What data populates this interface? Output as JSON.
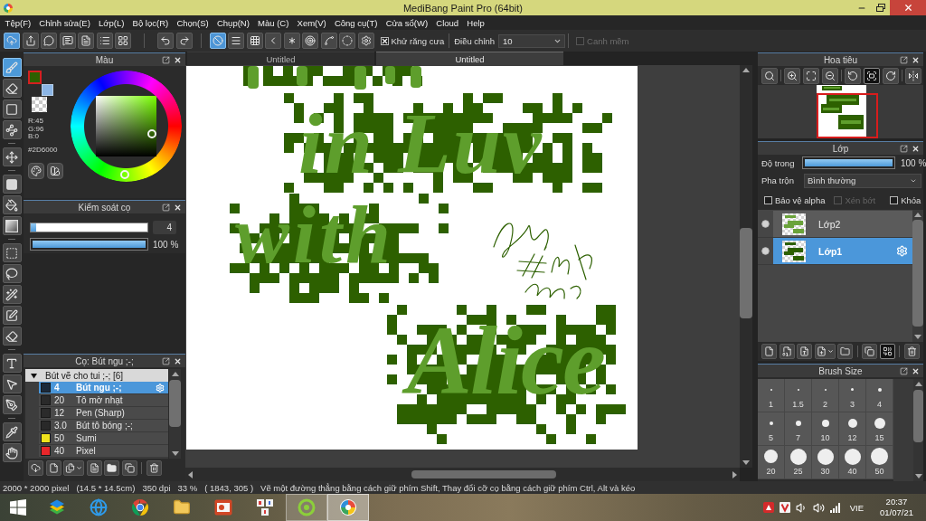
{
  "window": {
    "title": "MediBang Paint Pro (64bit)"
  },
  "menu": [
    "Tệp(F)",
    "Chỉnh sửa(E)",
    "Lớp(L)",
    "Bộ lọc(R)",
    "Chọn(S)",
    "Chụp(N)",
    "Màu (C)",
    "Xem(V)",
    "Công cụ(T)",
    "Cửa sổ(W)",
    "Cloud",
    "Help"
  ],
  "toolbar": {
    "groups": [
      {
        "items": [
          {
            "kind": "cloud-upload",
            "selected": true
          },
          {
            "kind": "share",
            "selected": false
          },
          {
            "kind": "bubble",
            "selected": false
          },
          {
            "kind": "comment",
            "selected": false
          },
          {
            "kind": "document",
            "selected": false
          },
          {
            "kind": "list",
            "selected": false
          },
          {
            "kind": "grid-settings",
            "selected": false
          }
        ]
      },
      {
        "items": [
          {
            "kind": "undo",
            "selected": false
          },
          {
            "kind": "redo",
            "selected": false
          }
        ]
      },
      {
        "items": [
          {
            "kind": "snap-off",
            "selected": true
          },
          {
            "kind": "snap-parallel",
            "selected": false
          },
          {
            "kind": "snap-grid",
            "selected": false
          },
          {
            "kind": "snap-perspective",
            "selected": false
          },
          {
            "kind": "snap-radial",
            "selected": false
          },
          {
            "kind": "snap-concentric",
            "selected": false
          },
          {
            "kind": "snap-curve",
            "selected": false
          },
          {
            "kind": "snap-ellipse",
            "selected": false
          },
          {
            "kind": "snap-settings",
            "selected": false
          }
        ]
      }
    ],
    "antialias": {
      "label": "Khử răng cưa",
      "checked": true
    },
    "correction": {
      "label": "Điều chỉnh",
      "value": "10"
    },
    "soft_edge": {
      "label": "Canh mềm",
      "checked": false,
      "disabled": true
    }
  },
  "tool_strip": {
    "groups": [
      {
        "items": [
          {
            "kind": "brush",
            "selected": true
          },
          {
            "kind": "eraser",
            "selected": false
          },
          {
            "kind": "rect-outline",
            "selected": false
          },
          {
            "kind": "dot-line",
            "selected": false
          }
        ]
      },
      {
        "items": [
          {
            "kind": "move",
            "selected": false
          }
        ]
      },
      {
        "items": [
          {
            "kind": "fill-rect",
            "selected": false
          },
          {
            "kind": "bucket",
            "selected": false
          },
          {
            "kind": "gradient",
            "selected": false
          }
        ]
      },
      {
        "items": [
          {
            "kind": "select-rect",
            "selected": false
          },
          {
            "kind": "lasso",
            "selected": false
          },
          {
            "kind": "wand",
            "selected": false
          },
          {
            "kind": "select-pen",
            "selected": false
          },
          {
            "kind": "select-eraser",
            "selected": false
          }
        ]
      },
      {
        "items": [
          {
            "kind": "text",
            "selected": false
          },
          {
            "kind": "operation",
            "selected": false
          },
          {
            "kind": "divide",
            "selected": false
          }
        ]
      },
      {
        "items": [
          {
            "kind": "eyedropper",
            "selected": false
          },
          {
            "kind": "hand",
            "selected": false
          }
        ]
      }
    ]
  },
  "color_panel": {
    "title": "Màu",
    "swatches": [
      {
        "kind": "foreground",
        "color": "#2d6000"
      },
      {
        "kind": "background",
        "color": "#8cb6e6"
      }
    ],
    "rgb": [
      "R:45",
      "G:96",
      "B:0"
    ],
    "hex": "#2D6000"
  },
  "brush_control": {
    "title": "Kiểm soát cọ",
    "size": {
      "level": 0.05,
      "value": "4"
    },
    "opacity": {
      "level": 1,
      "reading": "100 %"
    }
  },
  "brush_panel": {
    "title": "Cọ: Bút ngu ;-;",
    "groups": [
      {
        "label": "Bút vẽ cho tui ;-; [6]",
        "expanded": true,
        "children": [
          {
            "size": "4",
            "name": "Bút ngu ;-;",
            "color": "#1c2a3a",
            "selected": true
          },
          {
            "size": "20",
            "name": "Tô mờ nhạt",
            "color": "#2a2a2a",
            "selected": false
          },
          {
            "size": "12",
            "name": "Pen (Sharp)",
            "color": "#2b2b2b",
            "selected": false
          },
          {
            "size": "3.0",
            "name": "Bút tô bóng ;-;",
            "color": "#292929",
            "selected": false
          },
          {
            "size": "50",
            "name": "Sumi",
            "color": "#f0e21c",
            "selected": false
          },
          {
            "size": "40",
            "name": "Pixel",
            "color": "#e8262a",
            "selected": false
          }
        ]
      }
    ]
  },
  "canvas": {
    "tabs": [
      {
        "label": "Untitled",
        "selected": false
      },
      {
        "label": "Untitled",
        "selected": true
      }
    ],
    "lettering": [
      "in Luv",
      "with",
      "Alice"
    ]
  },
  "navigator": {
    "title": "Hoa tiêu",
    "groups": [
      {
        "items": [
          {
            "kind": "zoom-actual",
            "selected": false
          }
        ]
      },
      {
        "items": [
          {
            "kind": "zoom-in",
            "selected": false
          },
          {
            "kind": "fit",
            "selected": false
          },
          {
            "kind": "zoom-out",
            "selected": false
          }
        ]
      },
      {
        "items": [
          {
            "kind": "rotate-left",
            "selected": false
          },
          {
            "kind": "fit-screen",
            "selected": true
          },
          {
            "kind": "rotate-right",
            "selected": false
          }
        ]
      },
      {
        "items": [
          {
            "kind": "flip",
            "selected": false
          }
        ]
      }
    ]
  },
  "layers_panel": {
    "title": "Lớp",
    "opacity": {
      "label": "Độ trong",
      "level": 1,
      "reading": "100 %"
    },
    "blend": {
      "label": "Pha trộn",
      "value": "Bình thường"
    },
    "options": [
      {
        "label": "Bảo vệ alpha",
        "checked": false,
        "disabled": false
      },
      {
        "label": "Xén bớt",
        "checked": false,
        "disabled": true
      },
      {
        "label": "Khóa",
        "checked": false,
        "disabled": false
      }
    ],
    "layers": [
      {
        "name": "Lớp2",
        "visible": true,
        "selected": false
      },
      {
        "name": "Lớp1",
        "visible": true,
        "selected": true
      }
    ],
    "groups": [
      {
        "items": [
          {
            "kind": "new",
            "selected": false
          },
          {
            "kind": "new-8bit",
            "selected": false
          },
          {
            "kind": "new-1bit",
            "selected": false
          },
          {
            "kind": "add-menu",
            "selected": false
          },
          {
            "kind": "folder",
            "selected": false
          }
        ]
      },
      {
        "items": [
          {
            "kind": "duplicate",
            "selected": false
          },
          {
            "kind": "merge",
            "selected": true
          }
        ]
      },
      {
        "items": [
          {
            "kind": "trash",
            "selected": false
          }
        ]
      }
    ]
  },
  "brush_size": {
    "title": "Brush Size",
    "sizes": [
      "1",
      "1.5",
      "2",
      "3",
      "4",
      "5",
      "7",
      "10",
      "12",
      "15",
      "20",
      "25",
      "30",
      "40",
      "50"
    ]
  },
  "status_bar": {
    "items": [
      "2000 * 2000 pixel",
      "(14.5 * 14.5cm)",
      "350 dpi",
      "33 %",
      "( 1843, 305 )",
      "Vẽ một đường thẳng bằng cách giữ phím Shift, Thay đổi cỡ cọ bằng cách giữ phím Ctrl, Alt và kéo"
    ]
  },
  "taskbar": {
    "apps": [
      {
        "kind": "stack",
        "open": false,
        "selected": false
      },
      {
        "kind": "browser-e",
        "open": false,
        "selected": false
      },
      {
        "kind": "browser-c",
        "open": false,
        "selected": false
      },
      {
        "kind": "files",
        "open": false,
        "selected": false
      },
      {
        "kind": "slides",
        "open": false,
        "selected": false
      },
      {
        "kind": "tiles",
        "open": false,
        "selected": false
      },
      {
        "kind": "circle-app",
        "open": true,
        "selected": false
      },
      {
        "kind": "paint",
        "open": true,
        "selected": true
      }
    ],
    "tray": {
      "language": "VIE",
      "time": "20:37",
      "date": "01/07/21"
    }
  }
}
